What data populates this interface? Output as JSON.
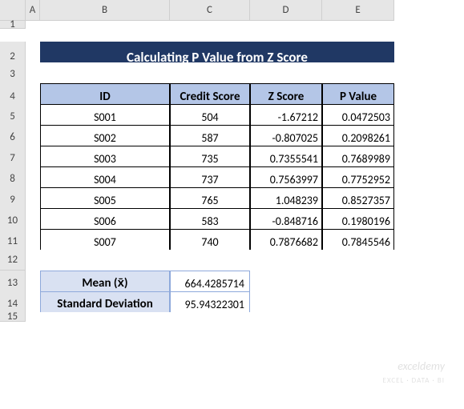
{
  "columns": [
    "",
    "A",
    "B",
    "C",
    "D",
    "E"
  ],
  "row_numbers": [
    "1",
    "2",
    "3",
    "4",
    "5",
    "6",
    "7",
    "8",
    "9",
    "10",
    "11",
    "12",
    "13",
    "14",
    "15"
  ],
  "title": "Calculating P Value from Z Score",
  "headers": {
    "id": "ID",
    "credit": "Credit Score",
    "z": "Z Score",
    "p": "P Value"
  },
  "rows": [
    {
      "id": "S001",
      "credit": "504",
      "z": "-1.67212",
      "p": "0.0472503"
    },
    {
      "id": "S002",
      "credit": "587",
      "z": "-0.807025",
      "p": "0.2098261"
    },
    {
      "id": "S003",
      "credit": "735",
      "z": "0.7355541",
      "p": "0.7689989"
    },
    {
      "id": "S004",
      "credit": "737",
      "z": "0.7563997",
      "p": "0.7752952"
    },
    {
      "id": "S005",
      "credit": "765",
      "z": "1.048239",
      "p": "0.8527357"
    },
    {
      "id": "S006",
      "credit": "583",
      "z": "-0.848716",
      "p": "0.1980196"
    },
    {
      "id": "S007",
      "credit": "740",
      "z": "0.7876682",
      "p": "0.7845546"
    }
  ],
  "summary": {
    "mean_label": "Mean (x̄)",
    "mean_value": "664.4285714",
    "std_label": "Standard Deviation",
    "std_value": "95.94322301"
  },
  "watermark": {
    "main": "exceldemy",
    "sub": "EXCEL · DATA · BI"
  },
  "chart_data": {
    "type": "table",
    "columns": [
      "ID",
      "Credit Score",
      "Z Score",
      "P Value"
    ],
    "rows": [
      [
        "S001",
        504,
        -1.67212,
        0.0472503
      ],
      [
        "S002",
        587,
        -0.807025,
        0.2098261
      ],
      [
        "S003",
        735,
        0.7355541,
        0.7689989
      ],
      [
        "S004",
        737,
        0.7563997,
        0.7752952
      ],
      [
        "S005",
        765,
        1.048239,
        0.8527357
      ],
      [
        "S006",
        583,
        -0.848716,
        0.1980196
      ],
      [
        "S007",
        740,
        0.7876682,
        0.7845546
      ]
    ],
    "summary": {
      "mean": 664.4285714,
      "std_dev": 95.94322301
    }
  }
}
